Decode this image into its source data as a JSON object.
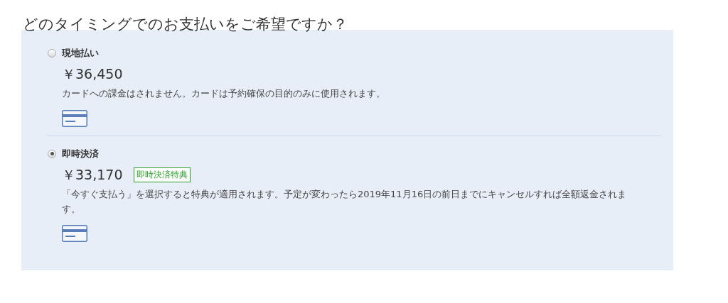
{
  "heading": "どのタイミングでのお支払いをご希望ですか？",
  "options": [
    {
      "label": "現地払い",
      "selected": false,
      "price": "￥36,450",
      "description": "カードへの課金はされません。カードは予約確保の目的のみに使用されます。"
    },
    {
      "label": "即時決済",
      "selected": true,
      "price": "￥33,170",
      "badge": "即時決済特典",
      "description": "「今すぐ支払う」を選択すると特典が適用されます。予定が変わったら2019年11月16日の前日までにキャンセルすれば全額返金されます。"
    }
  ]
}
